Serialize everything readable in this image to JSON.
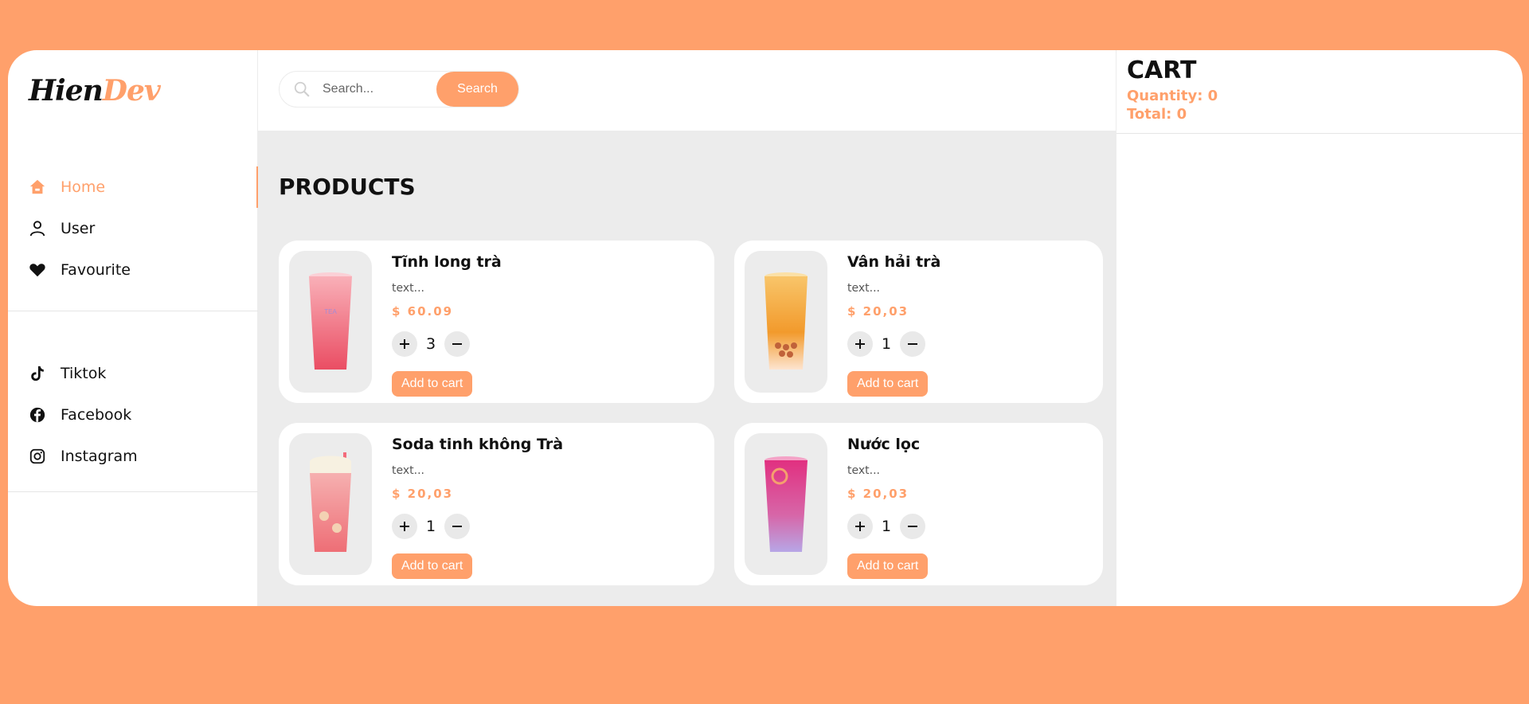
{
  "brand": {
    "part1": "Hien",
    "part2": "Dev"
  },
  "sidebar": {
    "nav": [
      {
        "label": "Home",
        "icon": "home-icon",
        "active": true
      },
      {
        "label": "User",
        "icon": "user-icon"
      },
      {
        "label": "Favourite",
        "icon": "heart-icon"
      }
    ],
    "social": [
      {
        "label": "Tiktok",
        "icon": "tiktok-icon"
      },
      {
        "label": "Facebook",
        "icon": "facebook-icon"
      },
      {
        "label": "Instagram",
        "icon": "instagram-icon"
      }
    ]
  },
  "search": {
    "placeholder": "Search...",
    "value": "",
    "button": "Search"
  },
  "main": {
    "title": "PRODUCTS"
  },
  "products": [
    {
      "name": "Tĩnh long trà",
      "desc": "text...",
      "price": "$ 60.09",
      "qty": "3",
      "add": "Add to cart",
      "drink_color": "#f26a7a"
    },
    {
      "name": "Vân hải trà",
      "desc": "text...",
      "price": "$ 20,03",
      "qty": "1",
      "add": "Add to cart",
      "drink_color": "#f6a72f"
    },
    {
      "name": "Soda tinh không Trà",
      "desc": "text...",
      "price": "$ 20,03",
      "qty": "1",
      "add": "Add to cart",
      "drink_color": "#f39598"
    },
    {
      "name": "Nước lọc",
      "desc": "text...",
      "price": "$ 20,03",
      "qty": "1",
      "add": "Add to cart",
      "drink_color": "#e2448a"
    }
  ],
  "cart": {
    "title": "CART",
    "quantity": "Quantity: 0",
    "total": "Total: 0"
  },
  "colors": {
    "accent": "#ffa06b",
    "panel": "#ececec"
  }
}
